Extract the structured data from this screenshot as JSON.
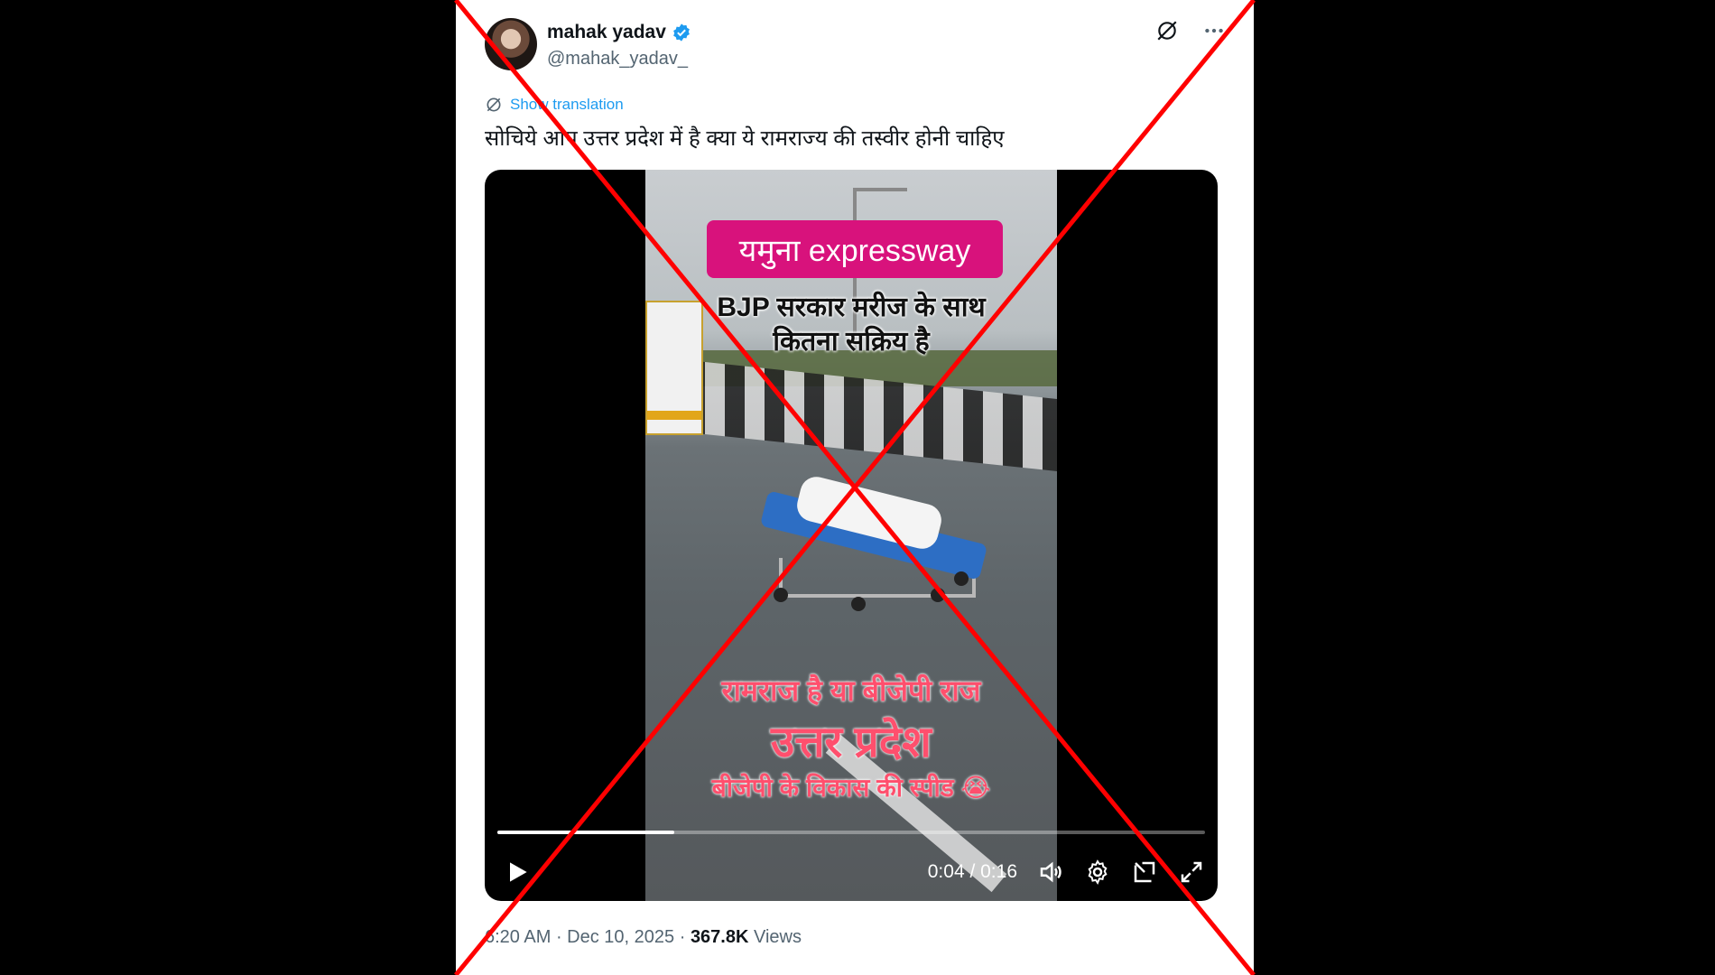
{
  "post": {
    "author_name": "mahak yadav",
    "author_handle": "@mahak_yadav_",
    "translate_label": "Show translation",
    "text": "सोचिये आप उत्तर प्रदेश में है क्या ये रामराज्य की तस्वीर होनी चाहिए"
  },
  "video": {
    "overlay_pill": "यमुना expressway",
    "overlay_line1": "BJP सरकार मरीज के साथ",
    "overlay_line2": "कितना सक्रिय है",
    "overlay_red1": "रामराज है या बीजेपी राज",
    "overlay_red2": "उत्तर प्रदेश",
    "overlay_red3": "बीजेपी के विकास की स्पीड 😭",
    "time": "0:04 / 0:16",
    "progress": 0.25
  },
  "meta": {
    "time": "6:20 AM",
    "separator1": " · ",
    "date": "Dec 10, 2025",
    "separator2": " · ",
    "views": "367.8K",
    "views_label": " Views"
  },
  "colors": {
    "verified": "#1d9bf0",
    "pill": "#d8127c",
    "overlay_red": "#ff4f6d",
    "cross": "#ff0000"
  },
  "icons": [
    "verified-badge-icon",
    "grok-icon",
    "more-icon",
    "translate-icon",
    "play-icon",
    "volume-icon",
    "settings-icon",
    "pip-icon",
    "fullscreen-icon"
  ]
}
